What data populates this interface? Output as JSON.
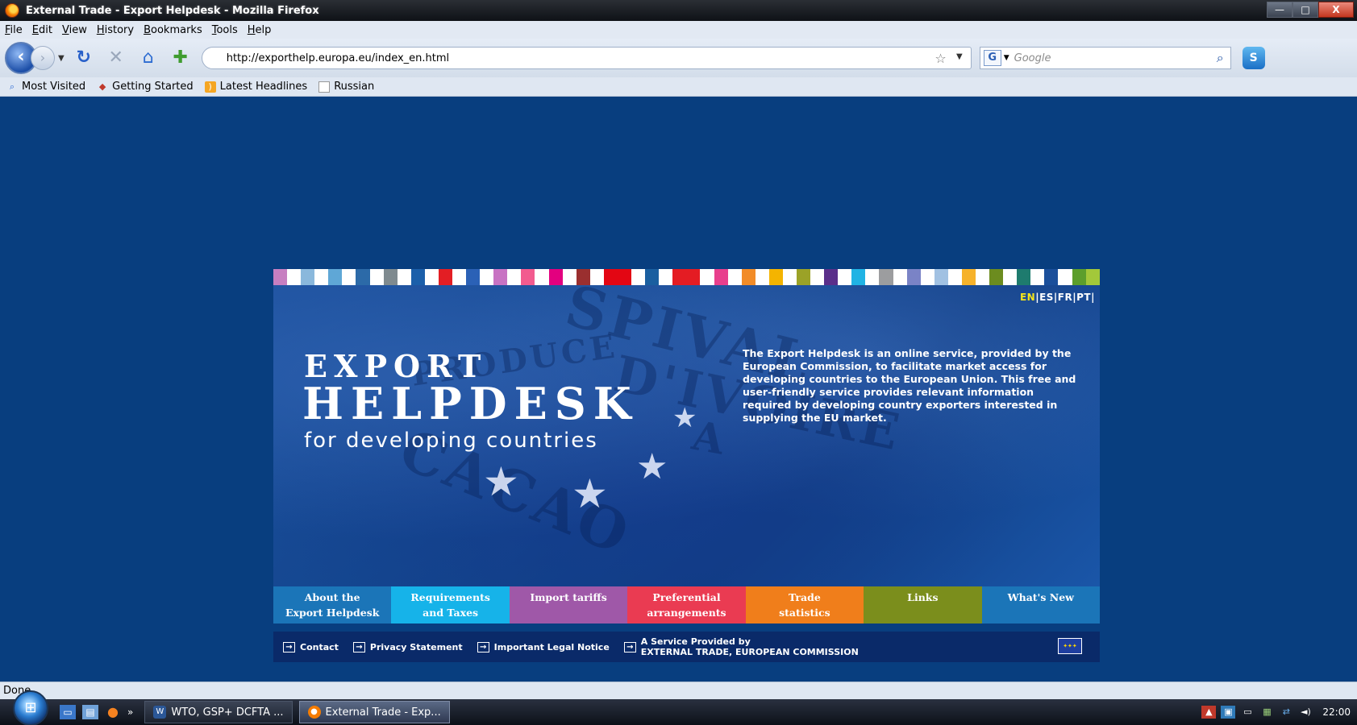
{
  "window": {
    "title": "External Trade - Export Helpdesk - Mozilla Firefox",
    "controls": {
      "minimize": "—",
      "maximize": "□",
      "close": "X"
    }
  },
  "menu": [
    "File",
    "Edit",
    "View",
    "History",
    "Bookmarks",
    "Tools",
    "Help"
  ],
  "nav": {
    "url": "http://exporthelp.europa.eu/index_en.html",
    "search_engine_icon": "G",
    "search_placeholder": "Google"
  },
  "bookmarks": [
    "Most Visited",
    "Getting Started",
    "Latest Headlines",
    "Russian"
  ],
  "page": {
    "color_strip": [
      "#c77fc1",
      "#ffffff",
      "#8ab8dc",
      "#ffffff",
      "#5fa7d6",
      "#ffffff",
      "#2c6aa8",
      "#ffffff",
      "#7f8a8f",
      "#ffffff",
      "#1b5faa",
      "#ffffff",
      "#e31e24",
      "#ffffff",
      "#2b61b6",
      "#ffffff",
      "#c873c3",
      "#ffffff",
      "#f25b8f",
      "#ffffff",
      "#e3007f",
      "#ffffff",
      "#9a2f2f",
      "#ffffff",
      "#e30613",
      "#e30613",
      "#ffffff",
      "#1a5fa0",
      "#ffffff",
      "#e41c23",
      "#e41c23",
      "#ffffff",
      "#e83f8d",
      "#ffffff",
      "#f28c28",
      "#ffffff",
      "#f4b400",
      "#ffffff",
      "#9ba227",
      "#ffffff",
      "#5a2f8a",
      "#ffffff",
      "#20b3e4",
      "#ffffff",
      "#9c9d9f",
      "#ffffff",
      "#7a83c6",
      "#ffffff",
      "#a1c1e2",
      "#ffffff",
      "#f6b22b",
      "#ffffff",
      "#6c8c1f",
      "#ffffff",
      "#1e7b6e",
      "#ffffff",
      "#1b4f9b",
      "#ffffff",
      "#5c9e2c",
      "#a3c83a"
    ],
    "languages": {
      "en": "EN",
      "others": "|ES|FR|PT|"
    },
    "brand": {
      "line1": "EXPORT",
      "line2": "HELPDESK",
      "line3": "for developing countries"
    },
    "intro": "The Export Helpdesk is an online service, provided by the European Commission, to facilitate market access for developing countries to the European Union. This free and user-friendly service provides relevant information required by developing country exporters interested in supplying the EU market.",
    "tabs": [
      {
        "line1": "About the",
        "line2": "Export Helpdesk",
        "color": "#1b75b8"
      },
      {
        "line1": "Requirements",
        "line2": "and Taxes",
        "color": "#16b3e9"
      },
      {
        "line1": "Import tariffs",
        "line2": "",
        "color": "#9f58a8"
      },
      {
        "line1": "Preferential",
        "line2": "arrangements",
        "color": "#ea3b52"
      },
      {
        "line1": "Trade",
        "line2": "statistics",
        "color": "#f07e1b"
      },
      {
        "line1": "Links",
        "line2": "",
        "color": "#7b8e1c"
      },
      {
        "line1": "What's New",
        "line2": "",
        "color": "#1b75b8"
      }
    ],
    "footer_links": {
      "contact": "Contact",
      "privacy": "Privacy Statement",
      "legal": "Important Legal Notice",
      "service_line1": "A Service Provided by",
      "service_line2": "EXTERNAL TRADE, EUROPEAN COMMISSION"
    }
  },
  "status": "Done",
  "taskbar": {
    "chevron": "»",
    "tasks": [
      "WTO, GSP+ DCFTA ...",
      "External Trade - Exp..."
    ],
    "clock": "22:00"
  }
}
